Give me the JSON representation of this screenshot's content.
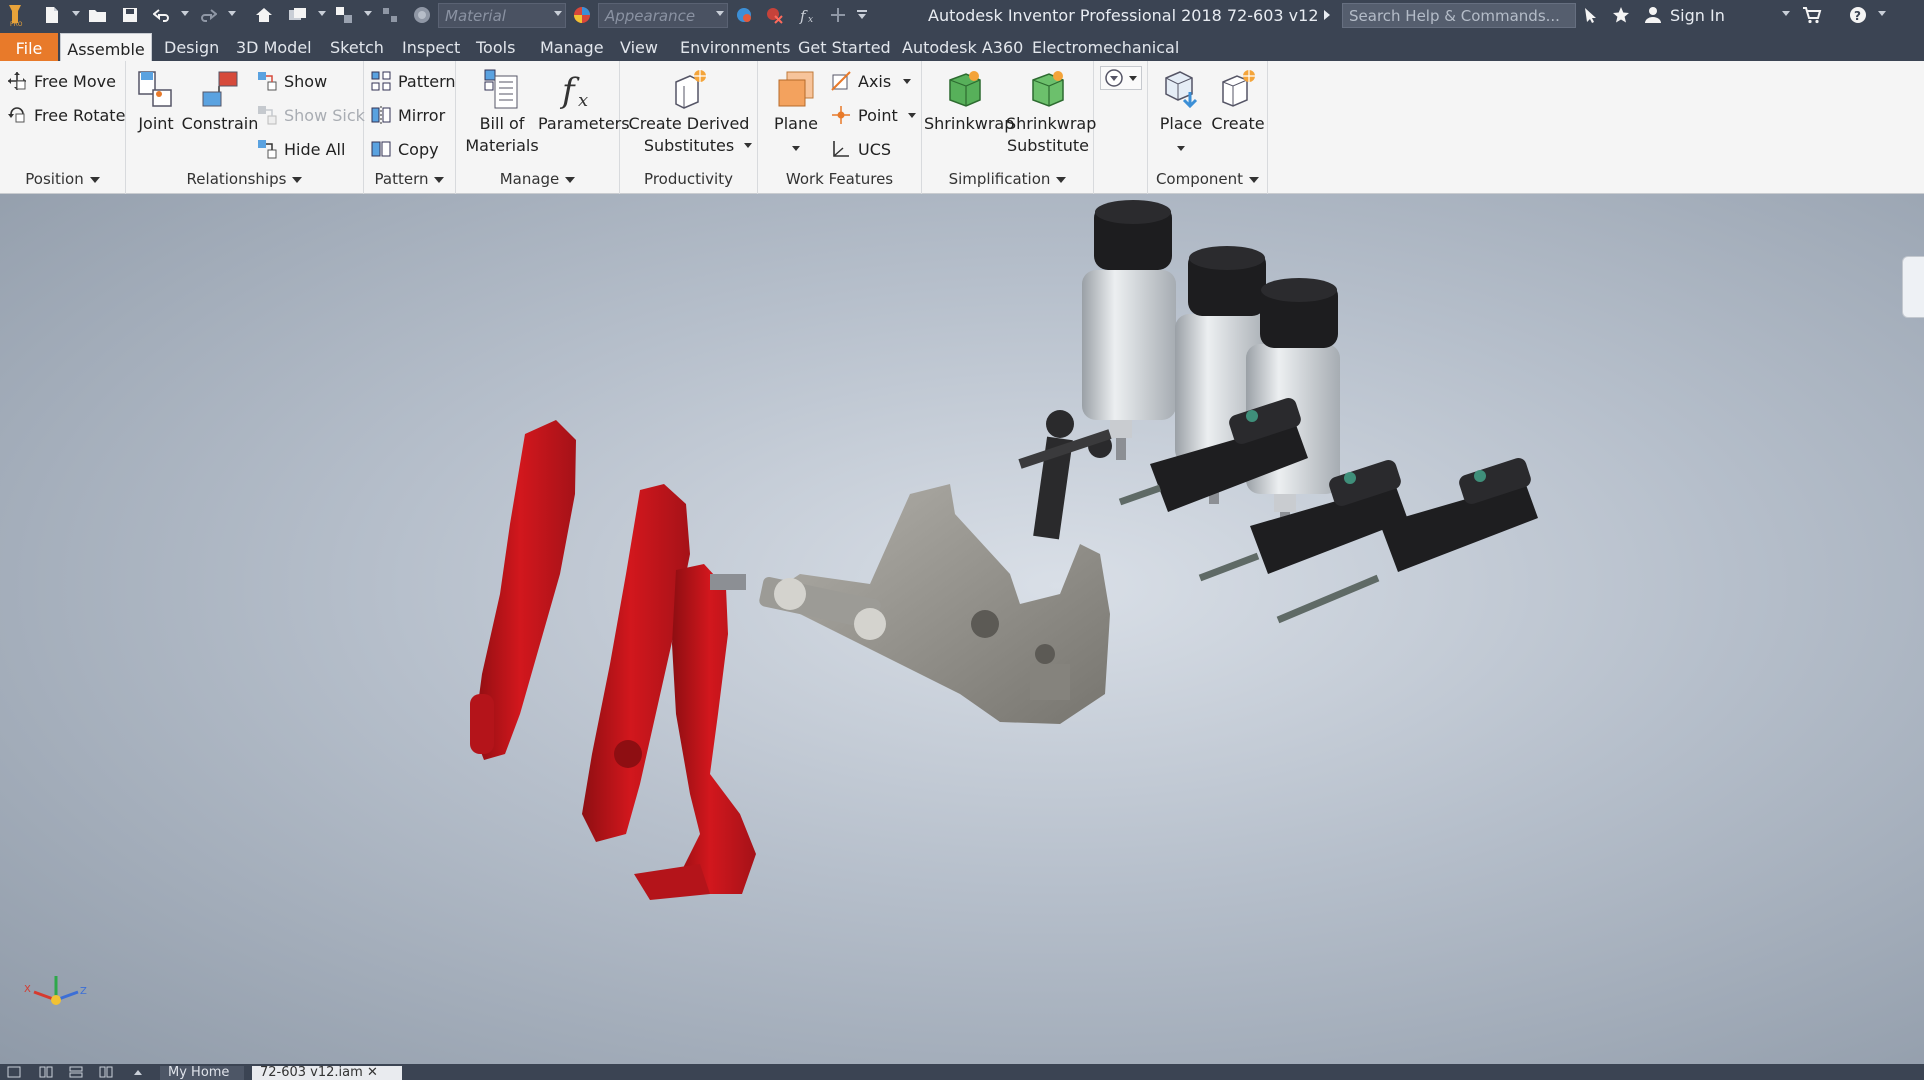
{
  "titlebar": {
    "app_title": "Autodesk Inventor Professional 2018   72-603 v12",
    "material_placeholder": "Material",
    "appearance_placeholder": "Appearance",
    "search_placeholder": "Search Help & Commands...",
    "signin_label": "Sign In"
  },
  "tabs": {
    "file": "File",
    "assemble": "Assemble",
    "design": "Design",
    "model3d": "3D Model",
    "sketch": "Sketch",
    "inspect": "Inspect",
    "tools": "Tools",
    "manage": "Manage",
    "view": "View",
    "environments": "Environments",
    "get_started": "Get Started",
    "a360": "Autodesk A360",
    "electromechanical": "Electromechanical"
  },
  "ribbon": {
    "position": {
      "title": "Position",
      "free_move": "Free Move",
      "free_rotate": "Free Rotate"
    },
    "relationships": {
      "title": "Relationships",
      "joint": "Joint",
      "constrain": "Constrain",
      "show": "Show",
      "show_sick": "Show Sick",
      "hide_all": "Hide All"
    },
    "pattern": {
      "title": "Pattern",
      "pattern": "Pattern",
      "mirror": "Mirror",
      "copy": "Copy"
    },
    "manage": {
      "title": "Manage",
      "bom_line1": "Bill of",
      "bom_line2": "Materials",
      "parameters": "Parameters"
    },
    "productivity": {
      "title": "Productivity",
      "line1": "Create Derived",
      "line2": "Substitutes"
    },
    "work_features": {
      "title": "Work Features",
      "plane": "Plane",
      "axis": "Axis",
      "point": "Point",
      "ucs": "UCS"
    },
    "simplification": {
      "title": "Simplification",
      "shrinkwrap": "Shrinkwrap",
      "sw_sub_line1": "Shrinkwrap",
      "sw_sub_line2": "Substitute"
    },
    "component": {
      "title": "Component",
      "place": "Place",
      "create": "Create"
    }
  },
  "bottom_tabs": {
    "home": "My Home",
    "active_doc": "72-603 v12.iam"
  },
  "colors": {
    "title_bar": "#3b4453",
    "file_tab": "#e87a2a",
    "pedal_red": "#c8151b",
    "ribbon_bg": "#f5f5f5"
  }
}
